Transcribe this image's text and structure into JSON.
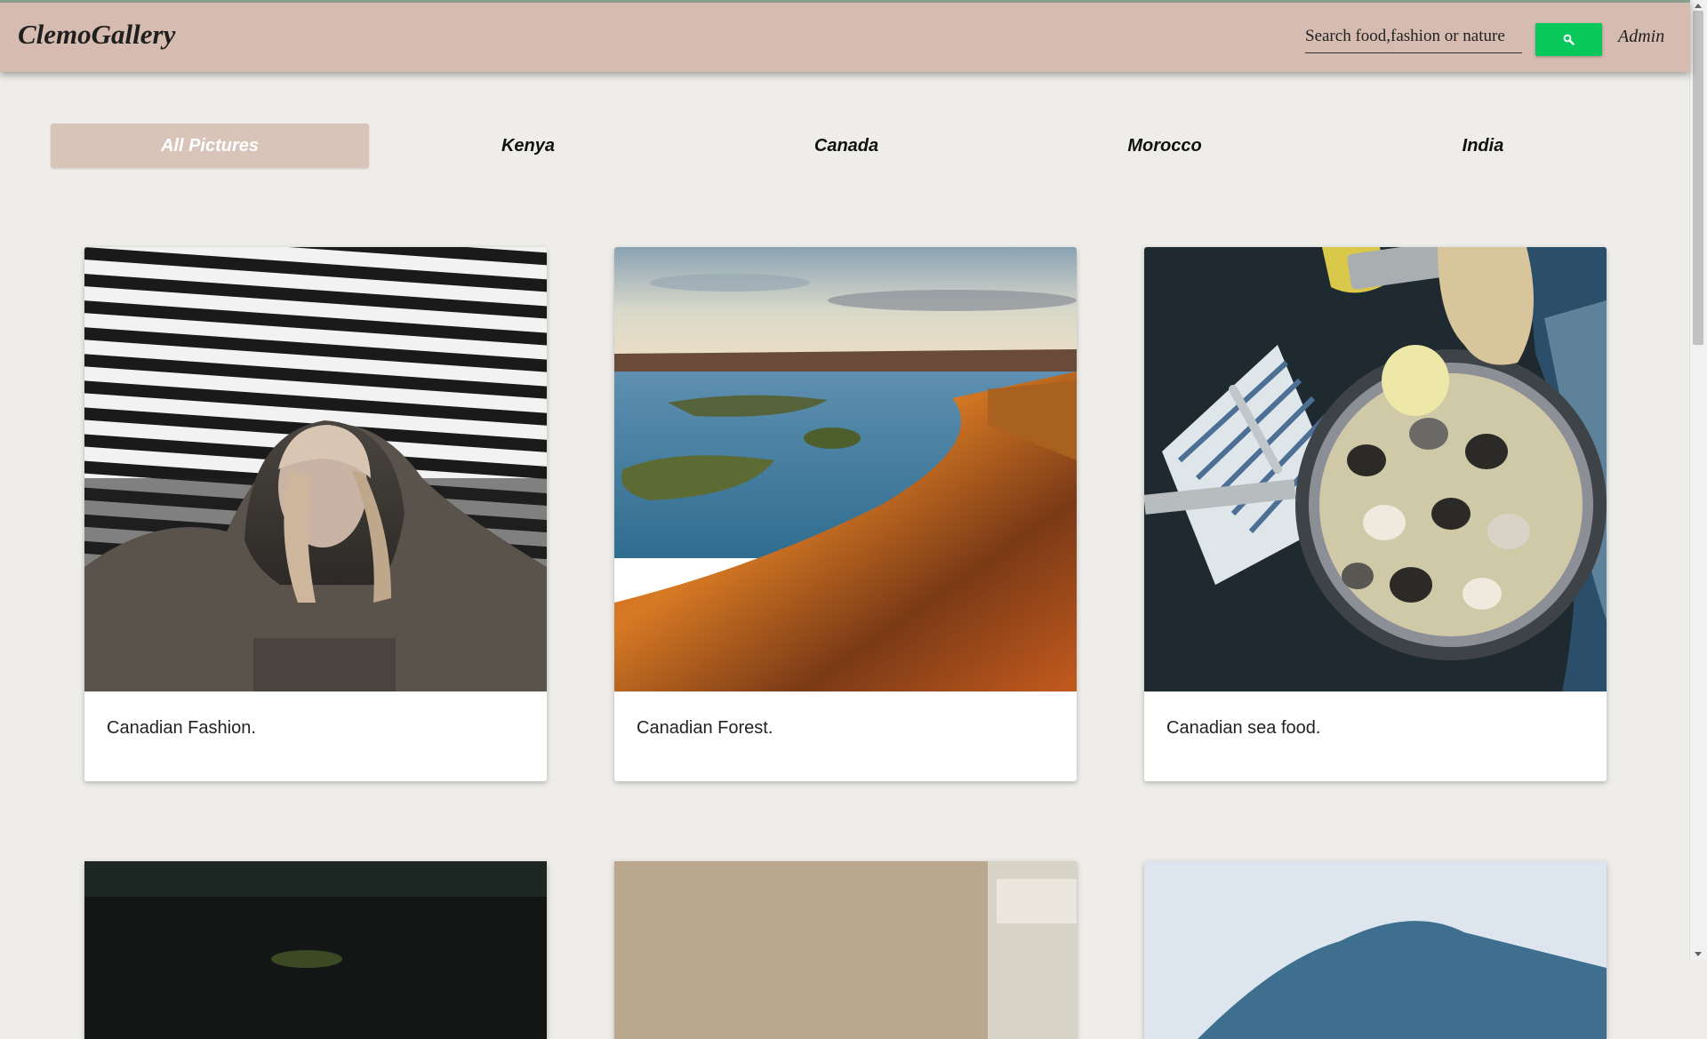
{
  "navbar": {
    "brand": "ClemoGallery",
    "search_placeholder": "Search food,fashion or nature",
    "search_button_icon": "search-icon",
    "admin_label": "Admin",
    "background": "#d6bcb0",
    "button_color": "#08c85c"
  },
  "tabs": [
    {
      "label": "All Pictures",
      "active": true
    },
    {
      "label": "Kenya",
      "active": false
    },
    {
      "label": "Canada",
      "active": false
    },
    {
      "label": "Morocco",
      "active": false
    },
    {
      "label": "India",
      "active": false
    }
  ],
  "cards": [
    {
      "caption": "Canadian Fashion.",
      "image": "woman-in-hoodie-photo"
    },
    {
      "caption": "Canadian Forest.",
      "image": "autumn-lake-forest-photo"
    },
    {
      "caption": "Canadian sea food.",
      "image": "clams-pan-photo"
    }
  ],
  "cards_row2": [
    {
      "image": "dark-plant-photo"
    },
    {
      "image": "beige-fabric-photo"
    },
    {
      "image": "mountain-sky-photo"
    }
  ]
}
